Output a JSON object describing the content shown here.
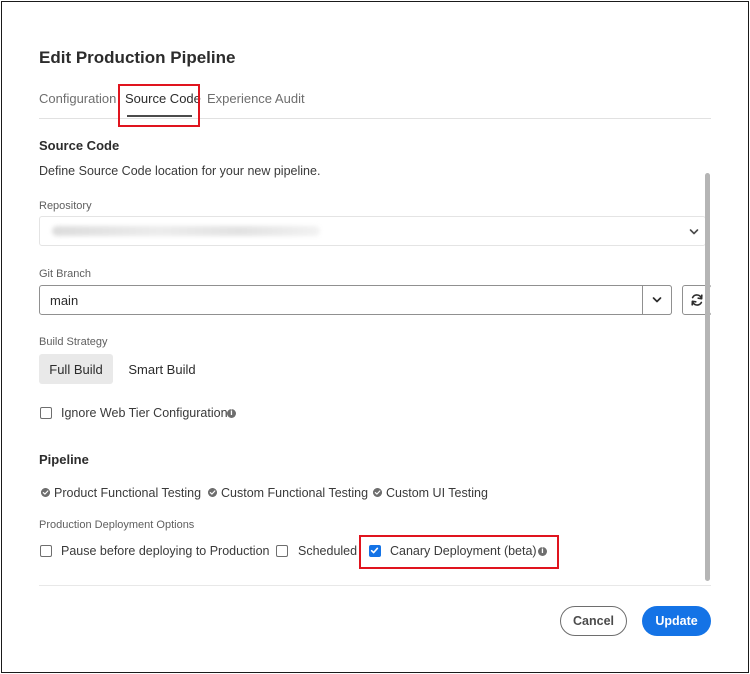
{
  "dialog": {
    "title": "Edit Production Pipeline"
  },
  "tabs": [
    {
      "label": "Configuration",
      "active": false
    },
    {
      "label": "Source Code",
      "active": true
    },
    {
      "label": "Experience Audit",
      "active": false
    }
  ],
  "source_code": {
    "heading": "Source Code",
    "description": "Define Source Code location for your new pipeline.",
    "repository": {
      "label": "Repository",
      "value": ""
    },
    "git_branch": {
      "label": "Git Branch",
      "value": "main"
    },
    "build_strategy": {
      "label": "Build Strategy",
      "options": [
        {
          "label": "Full Build",
          "selected": true
        },
        {
          "label": "Smart Build",
          "selected": false
        }
      ]
    },
    "ignore_web_tier": {
      "label": "Ignore Web Tier Configuration",
      "checked": false
    }
  },
  "pipeline": {
    "heading": "Pipeline",
    "tests": [
      {
        "label": "Product Functional Testing"
      },
      {
        "label": "Custom Functional Testing"
      },
      {
        "label": "Custom UI Testing"
      }
    ],
    "deployment_options": {
      "label": "Production Deployment Options",
      "options": [
        {
          "label": "Pause before deploying to Production",
          "checked": false
        },
        {
          "label": "Scheduled",
          "checked": false
        },
        {
          "label": "Canary Deployment (beta)",
          "checked": true
        }
      ]
    }
  },
  "footer": {
    "cancel_label": "Cancel",
    "update_label": "Update"
  },
  "colors": {
    "accent": "#1473e6",
    "highlight": "#e0141e",
    "text": "#2c2c2c"
  },
  "icons": {
    "dropdown": "chevron-down-icon",
    "refresh": "refresh-icon",
    "info": "info-icon",
    "check": "checkmark-badge-icon"
  }
}
